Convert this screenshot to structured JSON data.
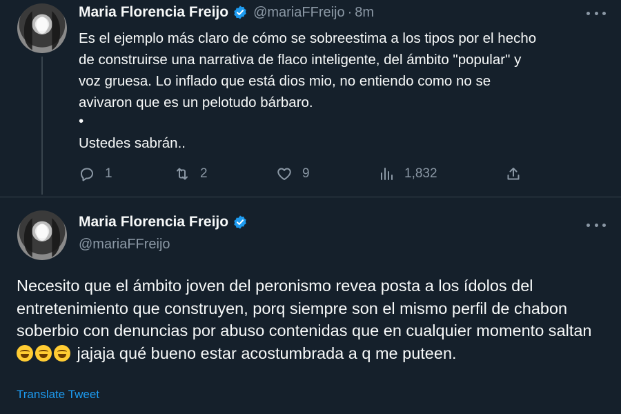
{
  "tweet1": {
    "author_name": "Maria Florencia Freijo",
    "handle": "@mariaFFreijo",
    "separator": "·",
    "time": "8m",
    "text_line1": "Es el ejemplo más claro de cómo se sobreestima a los tipos por el hecho",
    "text_line2": "de construirse una narrativa de flaco inteligente, del ámbito \"popular\" y",
    "text_line3": "voz gruesa. Lo inflado que está dios mio, no entiendo como no se",
    "text_line4": "avivaron que es un pelotudo bárbaro.",
    "bullet": "•",
    "closing": "Ustedes sabrán..",
    "replies": "1",
    "retweets": "2",
    "likes": "9",
    "views": "1,832"
  },
  "tweet2": {
    "author_name": "Maria Florencia Freijo",
    "handle": "@mariaFFreijo",
    "text_before_emoji": "Necesito que el ámbito joven del peronismo revea posta a los ídolos del entretenimiento que construyen, porq siempre son el mismo perfil de chabon soberbio con denuncias por abuso contenidas que en cualquier momento saltan ",
    "emoji_count": 3,
    "text_after_emoji": " jajaja qué bueno estar acostumbrada a q me puteen.",
    "translate_label": "Translate Tweet"
  },
  "icons": {
    "verified": "verified-badge-icon",
    "more": "more-options-icon",
    "reply": "reply-icon",
    "retweet": "retweet-icon",
    "like": "heart-icon",
    "views": "views-icon",
    "share": "share-icon"
  },
  "colors": {
    "background": "#15202b",
    "text": "#f7f9f9",
    "secondary": "#8b98a5",
    "accent": "#1d9bf0"
  }
}
